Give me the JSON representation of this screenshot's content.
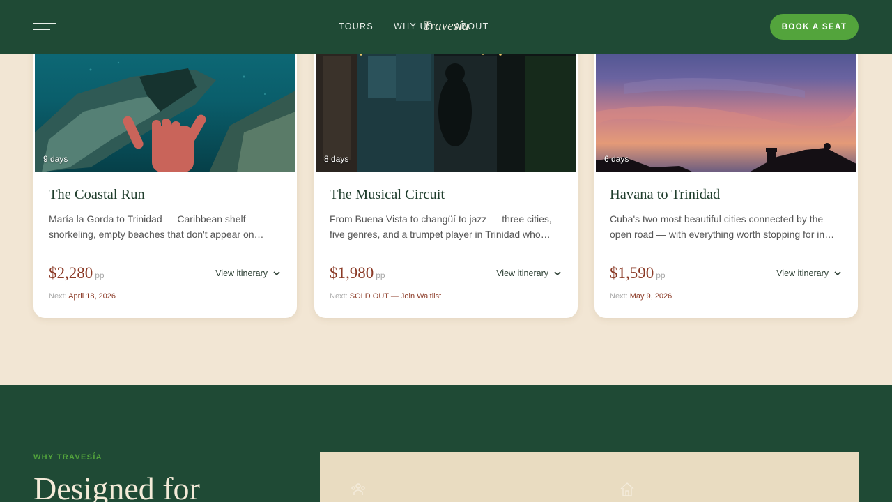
{
  "header": {
    "logo": "Travesía",
    "nav": [
      "TOURS",
      "WHY US",
      "ABOUT"
    ],
    "cta_label": "BOOK A SEAT",
    "menu_icon": "hamburger-icon"
  },
  "tours": [
    {
      "duration": "9 days",
      "title": "The Coastal Run",
      "description": "María la Gorda to Trinidad — Caribbean shelf snorkeling, empty beaches that don't appear on…",
      "price": "$2,280",
      "price_unit": "pp",
      "link_label": "View itinerary",
      "next_label": "Next:",
      "next_value": "April 18, 2026",
      "image": "underwater-shipwreck"
    },
    {
      "duration": "8 days",
      "title": "The Musical Circuit",
      "description": "From Buena Vista to changüí to jazz — three cities, five genres, and a trumpet player in Trinidad who…",
      "price": "$1,980",
      "price_unit": "pp",
      "link_label": "View itinerary",
      "next_label": "Next:",
      "next_value": "SOLD OUT — Join Waitlist",
      "image": "night-music-venue"
    },
    {
      "duration": "6 days",
      "title": "Havana to Trinidad",
      "description": "Cuba's two most beautiful cities connected by the open road — with everything worth stopping for in…",
      "price": "$1,590",
      "price_unit": "pp",
      "link_label": "View itinerary",
      "next_label": "Next:",
      "next_value": "May 9, 2026",
      "image": "sunset-rooftops"
    }
  ],
  "why": {
    "eyebrow": "WHY TRAVESÍA",
    "title": "Designed for",
    "icons": [
      "group-icon",
      "home-icon"
    ]
  },
  "colors": {
    "header_bg": "#1f4a35",
    "page_bg": "#f2e6d4",
    "accent_green": "#53a43c",
    "price": "#8b3a26",
    "panel_bg": "#e9dcc1"
  }
}
